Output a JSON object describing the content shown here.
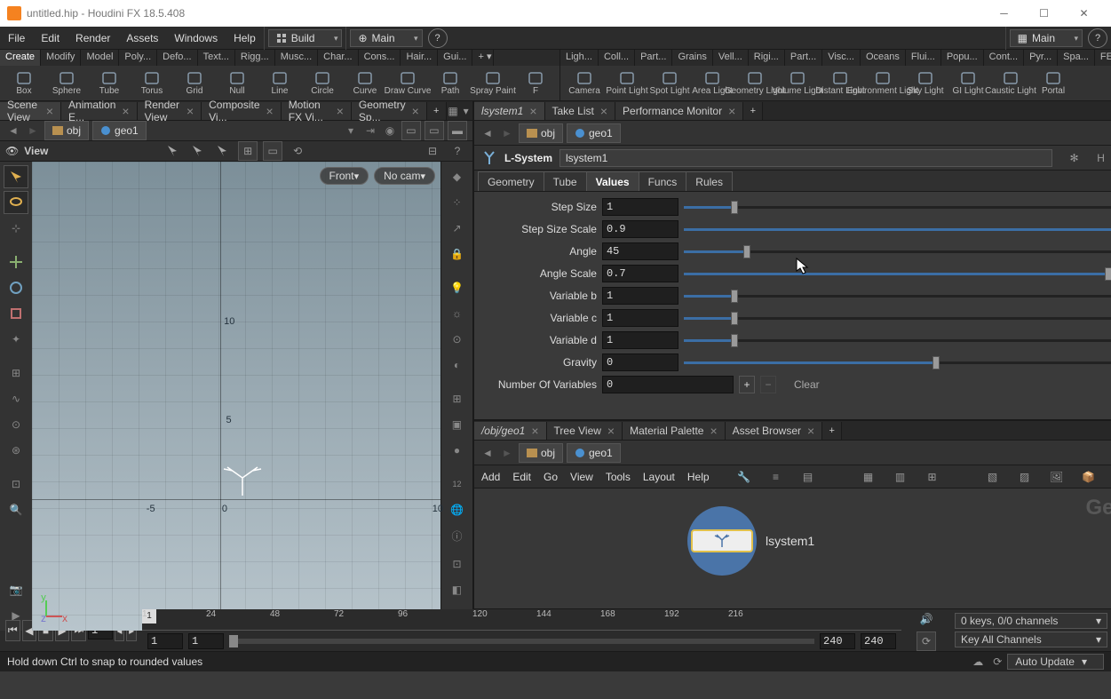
{
  "window": {
    "title": "untitled.hip - Houdini FX 18.5.408"
  },
  "menubar": {
    "items": [
      "File",
      "Edit",
      "Render",
      "Assets",
      "Windows",
      "Help"
    ],
    "desktop": "Build",
    "radial": "Main",
    "paneset": "Main"
  },
  "shelf_left": {
    "tabs": [
      "Create",
      "Modify",
      "Model",
      "Poly...",
      "Defo...",
      "Text...",
      "Rigg...",
      "Musc...",
      "Char...",
      "Cons...",
      "Hair...",
      "Gui..."
    ],
    "active": 0,
    "tools": [
      {
        "l": "Box"
      },
      {
        "l": "Sphere"
      },
      {
        "l": "Tube"
      },
      {
        "l": "Torus"
      },
      {
        "l": "Grid"
      },
      {
        "l": "Null"
      },
      {
        "l": "Line"
      },
      {
        "l": "Circle"
      },
      {
        "l": "Curve"
      },
      {
        "l": "Draw Curve"
      },
      {
        "l": "Path"
      },
      {
        "l": "Spray Paint"
      },
      {
        "l": "F"
      }
    ]
  },
  "shelf_right": {
    "tabs": [
      "Ligh...",
      "Coll...",
      "Part...",
      "Grains",
      "Vell...",
      "Rigi...",
      "Part...",
      "Visc...",
      "Oceans",
      "Flui...",
      "Popu...",
      "Cont...",
      "Pyr...",
      "Spa...",
      "FEM"
    ],
    "tools": [
      {
        "l": "Camera"
      },
      {
        "l": "Point Light"
      },
      {
        "l": "Spot Light"
      },
      {
        "l": "Area Light"
      },
      {
        "l": "Geometry\nLight"
      },
      {
        "l": "Volume Light"
      },
      {
        "l": "Distant Light"
      },
      {
        "l": "Environment\nLight"
      },
      {
        "l": "Sky Light"
      },
      {
        "l": "GI Light"
      },
      {
        "l": "Caustic Light"
      },
      {
        "l": "Portal"
      }
    ]
  },
  "left_tabs": [
    "Scene View",
    "Animation E...",
    "Render View",
    "Composite Vi...",
    "Motion FX Vi...",
    "Geometry Sp..."
  ],
  "left_path": {
    "obj": "obj",
    "geo": "geo1"
  },
  "view_label": "View",
  "viewport": {
    "cam_dd": "Front",
    "nocam": "No cam",
    "ticks": [
      "-5",
      "0",
      "5",
      "10"
    ],
    "yticks": [
      "5",
      "10"
    ]
  },
  "right_top_tabs": [
    "lsystem1",
    "Take List",
    "Performance Monitor"
  ],
  "right_path": {
    "obj": "obj",
    "geo": "geo1"
  },
  "node": {
    "type": "L-System",
    "name": "lsystem1"
  },
  "param_tabs": [
    "Geometry",
    "Tube",
    "Values",
    "Funcs",
    "Rules"
  ],
  "param_active": 2,
  "params": [
    {
      "l": "Step Size",
      "v": "1",
      "p": 0.1
    },
    {
      "l": "Step Size Scale",
      "v": "0.9",
      "p": 0.94
    },
    {
      "l": "Angle",
      "v": "45",
      "p": 0.125
    },
    {
      "l": "Angle Scale",
      "v": "0.7",
      "p": 0.84
    },
    {
      "l": "Variable b",
      "v": "1",
      "p": 0.1
    },
    {
      "l": "Variable c",
      "v": "1",
      "p": 0.1
    },
    {
      "l": "Variable d",
      "v": "1",
      "p": 0.1
    },
    {
      "l": "Gravity",
      "v": "0",
      "p": 0.5
    }
  ],
  "numvars": {
    "l": "Number Of Variables",
    "v": "0",
    "clear": "Clear"
  },
  "net_tabs": [
    "/obj/geo1",
    "Tree View",
    "Material Palette",
    "Asset Browser"
  ],
  "net_path": {
    "obj": "obj",
    "geo": "geo1"
  },
  "net_menu": [
    "Add",
    "Edit",
    "Go",
    "View",
    "Tools",
    "Layout",
    "Help"
  ],
  "net_watermark": "Geometry",
  "net_node": "lsystem1",
  "timeline": {
    "frame": "1",
    "start": "1",
    "rstart": "1",
    "end": "240",
    "rend": "240",
    "ticks": [
      {
        "n": "1",
        "x": 0
      },
      {
        "n": "24",
        "x": 72
      },
      {
        "n": "48",
        "x": 144
      },
      {
        "n": "72",
        "x": 216
      },
      {
        "n": "96",
        "x": 288
      },
      {
        "n": "120",
        "x": 372
      },
      {
        "n": "144",
        "x": 444
      },
      {
        "n": "168",
        "x": 516
      },
      {
        "n": "192",
        "x": 588
      },
      {
        "n": "216",
        "x": 660
      }
    ]
  },
  "keys": {
    "sel": "0 keys, 0/0 channels",
    "all": "Key All Channels"
  },
  "status": "Hold down Ctrl to snap to rounded values",
  "auto": "Auto Update"
}
